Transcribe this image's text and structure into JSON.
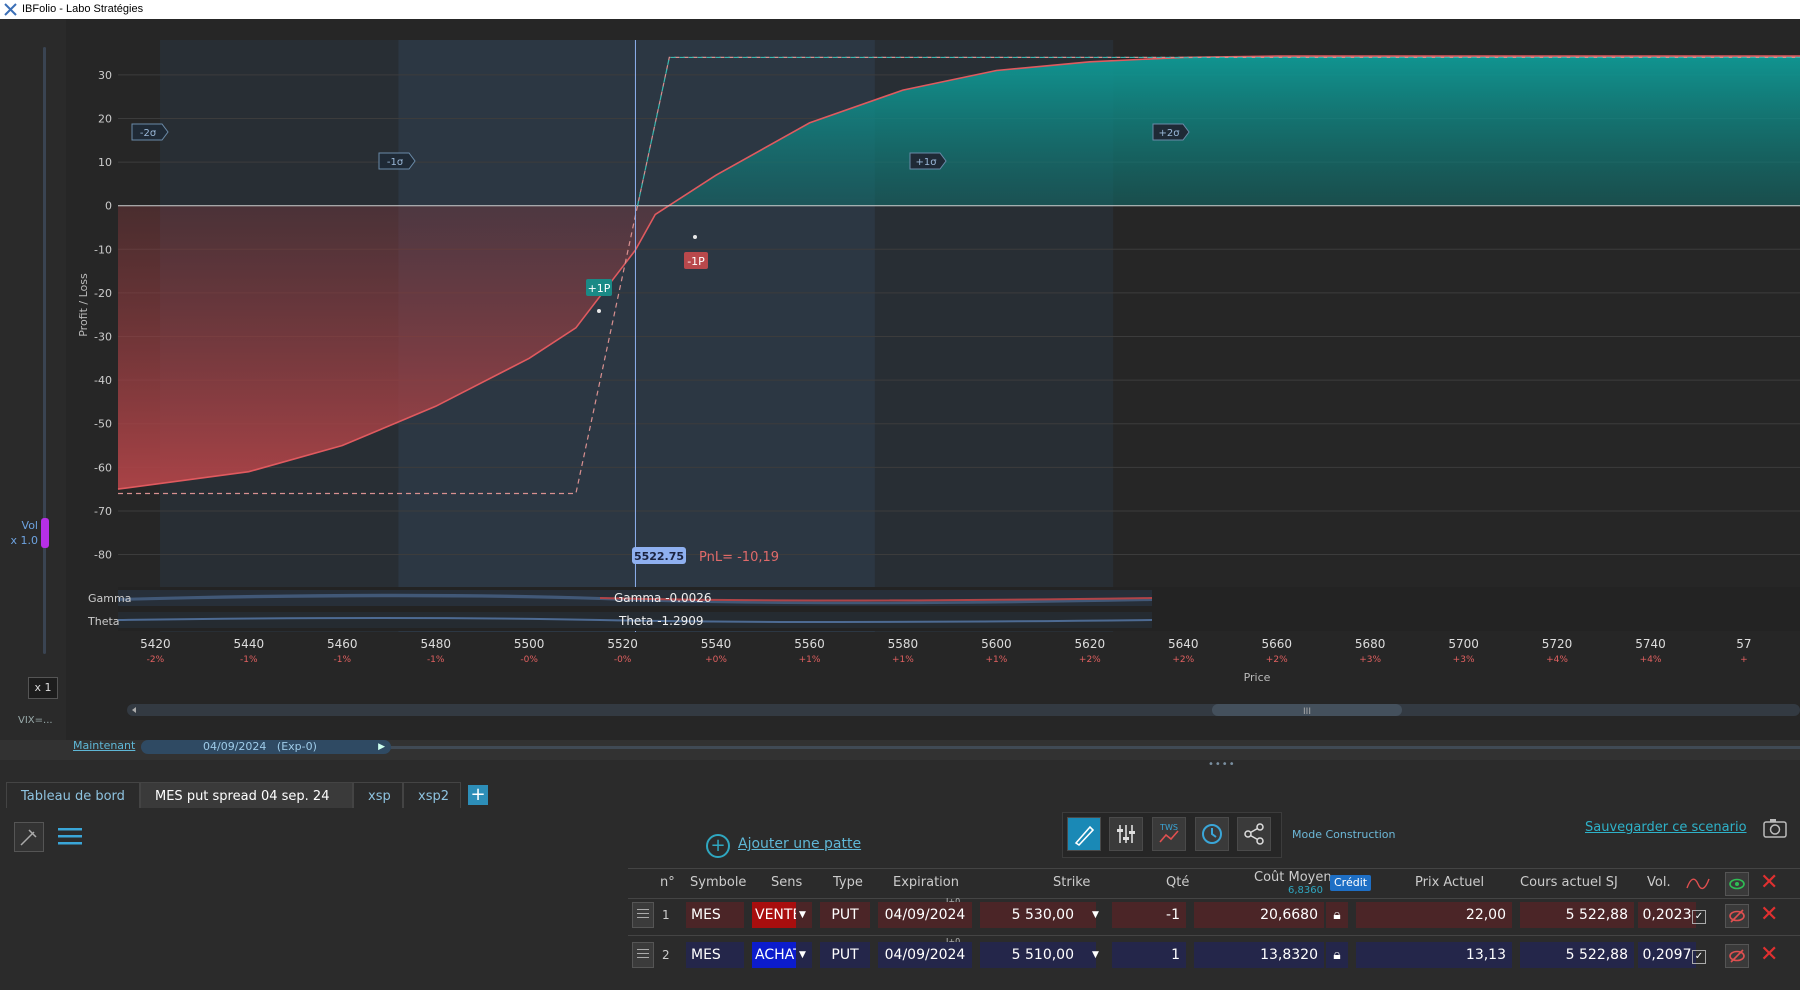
{
  "window": {
    "title": "IBFolio - Labo Stratégies"
  },
  "chart": {
    "ylabel": "Profit / Loss",
    "xlabel": "Price",
    "y_ticks": [
      "30",
      "20",
      "10",
      "0",
      "-10",
      "-20",
      "-30",
      "-40",
      "-50",
      "-60",
      "-70",
      "-80"
    ],
    "x_ticks": [
      "5420",
      "5440",
      "5460",
      "5480",
      "5500",
      "5520",
      "5540",
      "5560",
      "5580",
      "5600",
      "5620",
      "5640",
      "5660",
      "5680",
      "5700",
      "5720",
      "5740",
      "57"
    ],
    "x_pct": [
      "-2%",
      "-1%",
      "-1%",
      "-1%",
      "-0%",
      "-0%",
      "+0%",
      "+1%",
      "+1%",
      "+1%",
      "+2%",
      "+2%",
      "+2%",
      "+3%",
      "+3%",
      "+4%",
      "+4%",
      "+"
    ],
    "sigma_labels": [
      "-2σ",
      "-1σ",
      "+1σ",
      "+2σ"
    ],
    "marker_long": "+1P",
    "marker_short": "-1P",
    "cursor_price": "5522.75",
    "cursor_pnl": "PnL= -10,19",
    "gamma_label": "Gamma",
    "theta_label": "Theta",
    "gamma_value": "Gamma -0.0026",
    "theta_value": "Theta -1.2909",
    "colors": {
      "profit": "#0e8f8c",
      "loss": "#a83a40",
      "cursor": "#7f9ff0",
      "expiry": "#e08a8a"
    }
  },
  "chart_data": {
    "type": "line",
    "xlabel": "Price",
    "ylabel": "Profit / Loss",
    "xlim": [
      5412,
      5772
    ],
    "ylim": [
      -84,
      38
    ],
    "series": [
      {
        "name": "",
        "x": [
          5412,
          5440,
          5460,
          5480,
          5500,
          5510,
          5520,
          5522.75,
          5527,
          5540,
          5560,
          5580,
          5600,
          5620,
          5640,
          5660,
          5680,
          5700,
          5720,
          5740,
          5772
        ],
        "values": [
          -65,
          -61,
          -55,
          -46,
          -35,
          -28,
          -14,
          -10.19,
          -2,
          7,
          19,
          26.5,
          31,
          33,
          34,
          34.3,
          34.3,
          34.3,
          34.3,
          34.3,
          34.3
        ]
      },
      {
        "name": "",
        "x": [
          5412,
          5510,
          5530,
          5772
        ],
        "values": [
          -66,
          -66,
          34,
          34
        ]
      }
    ],
    "sigma_x": [
      5421,
      5472,
      5574,
      5625
    ],
    "cursor_x": 5522.75,
    "cursor_pnl": -10.19,
    "grid": true
  },
  "left": {
    "vol_label": "Vol",
    "vol_mult": "x 1.0",
    "x1": "x 1",
    "vix": "VIX=..."
  },
  "timeline": {
    "now": "Maintenant",
    "date": "04/09/2024",
    "exp": "(Exp-0)"
  },
  "tabs": [
    {
      "label": "Tableau de bord"
    },
    {
      "label": "MES put spread 04 sep. 24"
    },
    {
      "label": "xsp"
    },
    {
      "label": "xsp2"
    }
  ],
  "actions": {
    "add_leg": "Ajouter une patte",
    "mode": "Mode Construction",
    "save": "Sauvegarder ce scenario",
    "tws": "TWS"
  },
  "table": {
    "headers": {
      "n": "n°",
      "symbol": "Symbole",
      "sens": "Sens",
      "type": "Type",
      "exp": "Expiration",
      "strike": "Strike",
      "qty": "Qté",
      "cost": "Coût Moyen",
      "cost_sub": "6,8360",
      "credit": "Crédit",
      "price": "Prix Actuel",
      "underlying": "Cours actuel SJ",
      "vol": "Vol."
    },
    "rows": [
      {
        "n": "1",
        "symbol": "MES",
        "sens": "VENTE",
        "type": "PUT",
        "exp_tag": "J+0",
        "exp": "04/09/2024",
        "strike": "5 530,00",
        "qty": "-1",
        "cost": "20,6680",
        "price": "22,00",
        "underlying": "5 522,88",
        "vol": "0,2023"
      },
      {
        "n": "2",
        "symbol": "MES",
        "sens": "ACHAT",
        "type": "PUT",
        "exp_tag": "J+0",
        "exp": "04/09/2024",
        "strike": "5 510,00",
        "qty": "1",
        "cost": "13,8320",
        "price": "13,13",
        "underlying": "5 522,88",
        "vol": "0,2097"
      }
    ]
  }
}
